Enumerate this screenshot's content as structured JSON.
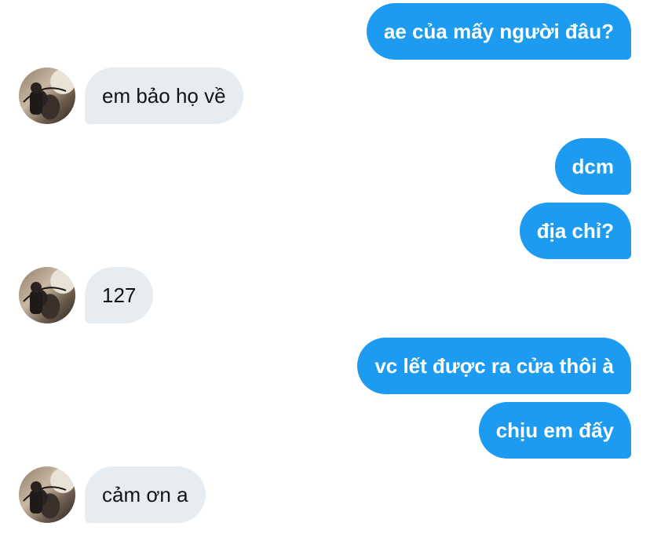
{
  "chat": {
    "messages": [
      {
        "sender": "me",
        "text": "ae của mấy người đâu?"
      },
      {
        "sender": "them",
        "text": "em bảo họ về"
      },
      {
        "sender": "me",
        "text": "dcm"
      },
      {
        "sender": "me",
        "text": "địa chỉ?"
      },
      {
        "sender": "them",
        "text": "127"
      },
      {
        "sender": "me",
        "text": "vc lết được ra cửa thôi à"
      },
      {
        "sender": "me",
        "text": "chịu em đấy"
      },
      {
        "sender": "them",
        "text": "cảm ơn a"
      }
    ]
  },
  "colors": {
    "sent_bubble": "#1d9bf0",
    "received_bubble": "#e7ecf1",
    "sent_text": "#ffffff",
    "received_text": "#0f1419"
  }
}
